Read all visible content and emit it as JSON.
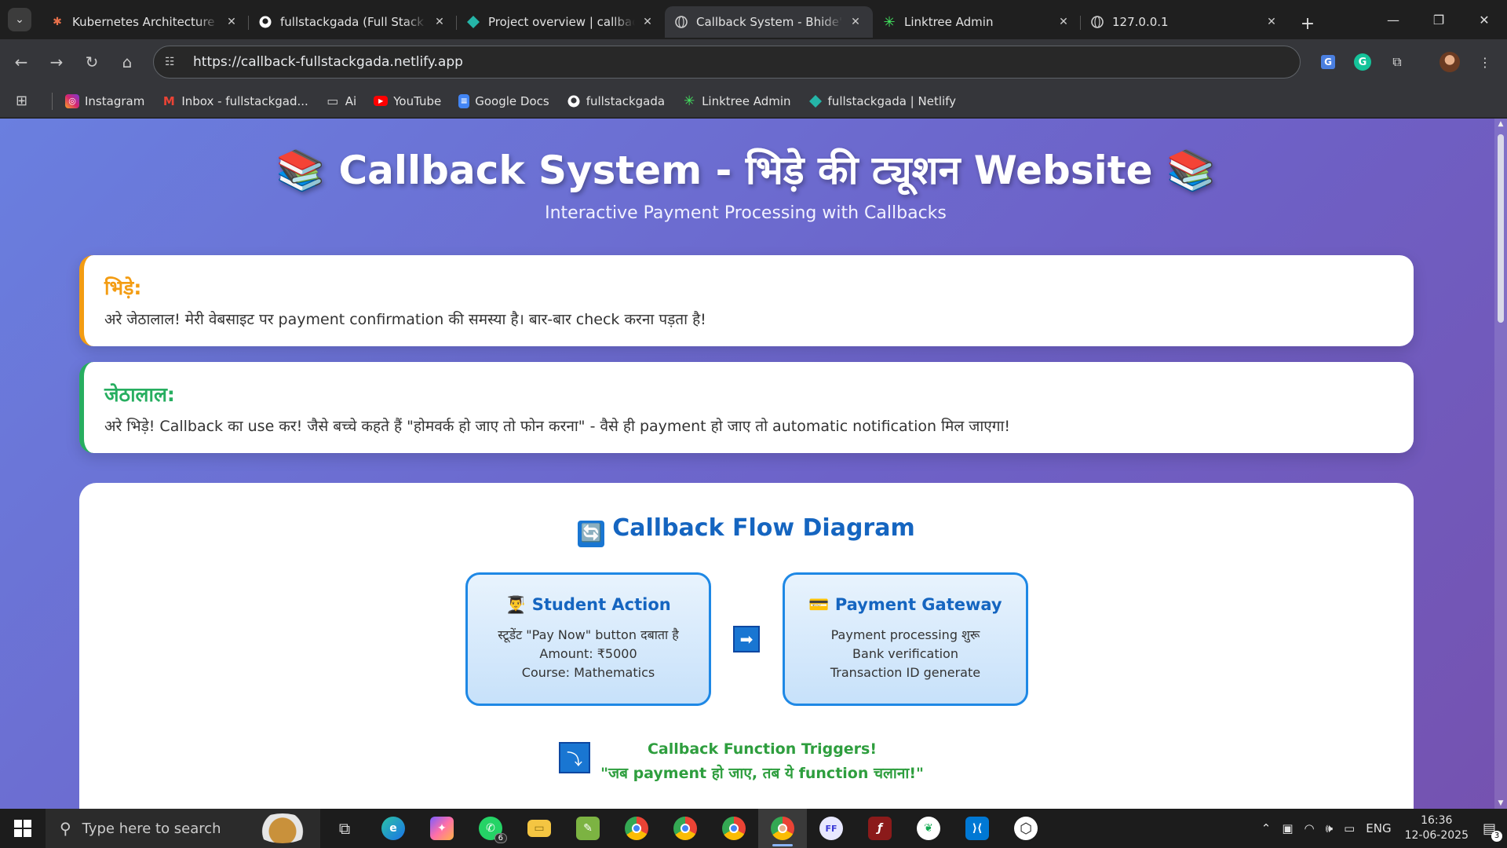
{
  "browser": {
    "tabs": [
      {
        "title": "Kubernetes Architecture D",
        "favicon": "asterisk-icon",
        "color": "#e8704a",
        "active": false
      },
      {
        "title": "fullstackgada (Full Stack Ga",
        "favicon": "github-icon",
        "color": "#ffffff",
        "active": false
      },
      {
        "title": "Project overview | callback",
        "favicon": "netlify-icon",
        "color": "#25b5a8",
        "active": false
      },
      {
        "title": "Callback System - Bhide's T",
        "favicon": "globe-icon",
        "color": "#cccccc",
        "active": true
      },
      {
        "title": "Linktree Admin",
        "favicon": "linktree-icon",
        "color": "#43e660",
        "active": false
      },
      {
        "title": "127.0.0.1",
        "favicon": "globe-icon",
        "color": "#cccccc",
        "active": false
      }
    ],
    "url": "https://callback-fullstackgada.netlify.app",
    "bookmarks": [
      {
        "label": "Instagram",
        "icon": "instagram-icon",
        "color": "#d6246e"
      },
      {
        "label": "Inbox - fullstackgad...",
        "icon": "gmail-icon",
        "color": "#ea4335"
      },
      {
        "label": "Ai",
        "icon": "folder-icon",
        "color": "#cccccc"
      },
      {
        "label": "YouTube",
        "icon": "youtube-icon",
        "color": "#ff0000"
      },
      {
        "label": "Google Docs",
        "icon": "docs-icon",
        "color": "#4285f4"
      },
      {
        "label": "fullstackgada",
        "icon": "github-icon",
        "color": "#ffffff"
      },
      {
        "label": "Linktree Admin",
        "icon": "linktree-icon",
        "color": "#43e660"
      },
      {
        "label": "fullstackgada | Netlify",
        "icon": "netlify-icon",
        "color": "#25b5a8"
      }
    ]
  },
  "page": {
    "title": "📚 Callback System - भिड़े की ट्यूशन Website 📚",
    "subtitle": "Interactive Payment Processing with Callbacks",
    "dialogs": [
      {
        "speaker": "भिड़े:",
        "text": "अरे जेठालाल! मेरी वेबसाइट पर payment confirmation की समस्या है। बार-बार check करना पड़ता है!",
        "accent": "#f39c12"
      },
      {
        "speaker": "जेठालाल:",
        "text": "अरे भिड़े! Callback का use कर! जैसे बच्चे कहते हैं \"होमवर्क हो जाए तो फोन करना\" - वैसे ही payment हो जाए तो automatic notification मिल जाएगा!",
        "accent": "#27ae60"
      }
    ],
    "flow": {
      "title": "Callback Flow Diagram",
      "title_icon": "🔄",
      "boxes": [
        {
          "heading": "👨‍🎓 Student Action",
          "lines": [
            "स्टूडेंट \"Pay Now\" button दबाता है",
            "Amount: ₹5000",
            "Course: Mathematics"
          ]
        },
        {
          "heading": "💳 Payment Gateway",
          "lines": [
            "Payment processing शुरू",
            "Bank verification",
            "Transaction ID generate"
          ]
        }
      ],
      "arrow_right": "➡",
      "arrow_down": "⤵",
      "trigger_title": "Callback Function Triggers!",
      "trigger_text": "\"जब payment हो जाए, तब ये function चलाना!\""
    }
  },
  "taskbar": {
    "search_placeholder": "Type here to search",
    "whatsapp_badge": "6",
    "language": "ENG",
    "time": "16:36",
    "date": "12-06-2025",
    "notifications": "3"
  },
  "colors": {
    "accent_blue": "#1565c0",
    "green": "#2e9e3e",
    "orange": "#f39c12"
  }
}
